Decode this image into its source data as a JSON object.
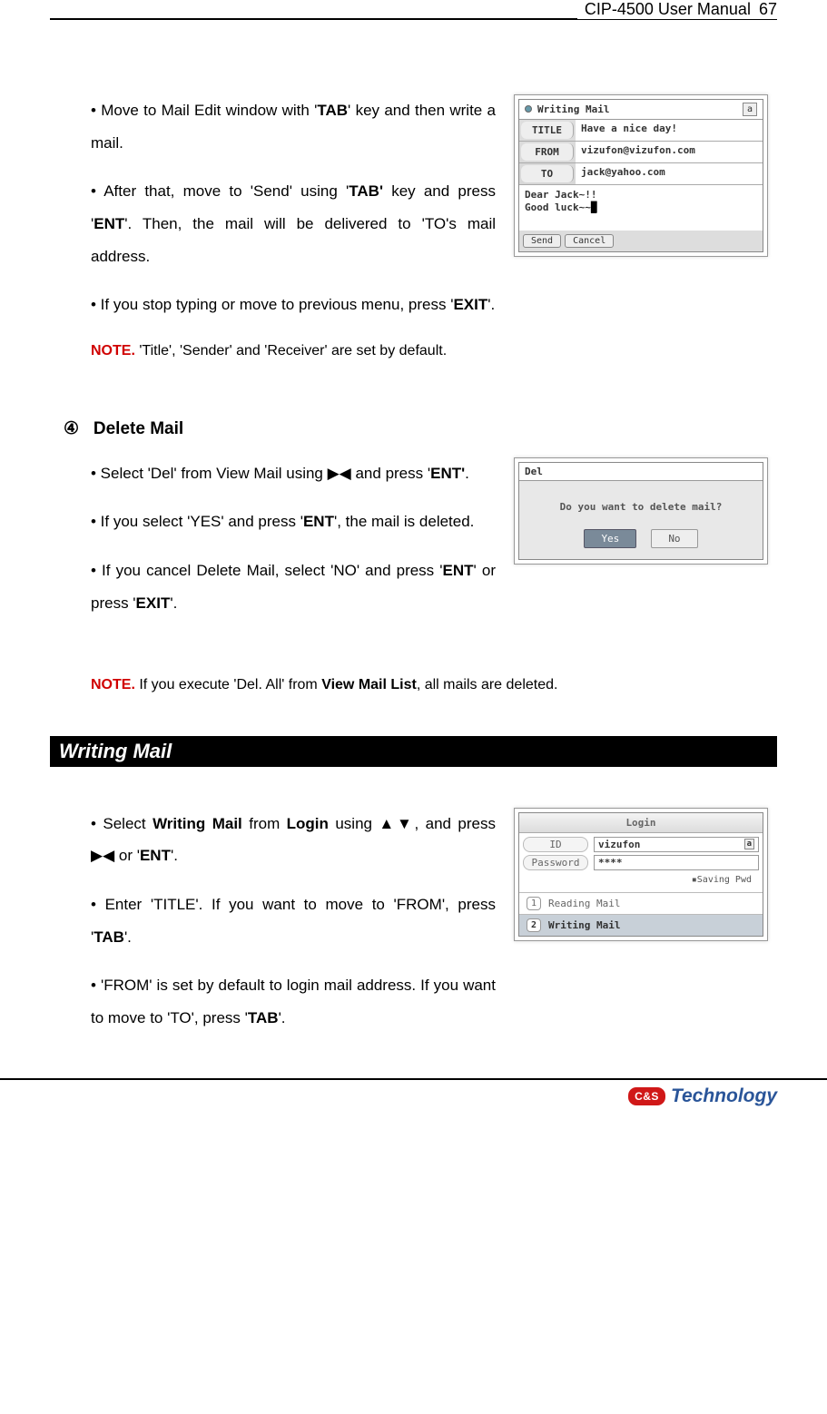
{
  "header": {
    "title": "CIP-4500 User Manual",
    "page": "67"
  },
  "section1": {
    "p1_pre": "• Move to Mail Edit window with '",
    "p1_bold": "TAB",
    "p1_post": "' key and then write a mail.",
    "p2_a": "• After that, move to 'Send' using '",
    "p2_b1": "TAB'",
    "p2_c": " key and press '",
    "p2_b2": "ENT",
    "p2_d": "'. Then, the mail will be delivered to 'TO's mail address.",
    "p3_a": "• If you stop typing or move to previous menu, press '",
    "p3_b": "EXIT",
    "p3_c": "'.",
    "note_label": "NOTE.",
    "note_text": " 'Title', 'Sender' and 'Receiver' are set by default."
  },
  "shot1": {
    "window_title": "Writing Mail",
    "lang": "a",
    "title_lbl": "TITLE",
    "title_val": "Have a nice day!",
    "from_lbl": "FROM",
    "from_val": "vizufon@vizufon.com",
    "to_lbl": "TO",
    "to_val": "jack@yahoo.com",
    "body_line1": "Dear Jack~!!",
    "body_line2": "Good luck~~",
    "btn_send": "Send",
    "btn_cancel": "Cancel"
  },
  "section2": {
    "heading_num": "④",
    "heading_text": "Delete Mail",
    "p1_a": "• Select 'Del' from View Mail using ▶◀ and press '",
    "p1_b": "ENT'",
    "p1_c": ".",
    "p2_a": "• If you select 'YES' and press '",
    "p2_b": "ENT",
    "p2_c": "', the mail is deleted.",
    "p3_a": "• If you cancel Delete Mail, select 'NO' and press '",
    "p3_b": "ENT",
    "p3_c": "' or press '",
    "p3_d": "EXIT",
    "p3_e": "'.",
    "note_label": "NOTE.",
    "note_a": " If you execute 'Del. All' from ",
    "note_b": "View Mail List",
    "note_c": ", all mails are deleted."
  },
  "shot2": {
    "title": "Del",
    "question": "Do you want to delete mail?",
    "yes": "Yes",
    "no": "No"
  },
  "section3": {
    "banner": "Writing Mail",
    "p1_a": "• Select ",
    "p1_b1": "Writing Mail",
    "p1_c": " from ",
    "p1_b2": "Login",
    "p1_d": " using ▲▼, and press ▶◀ or '",
    "p1_b3": "ENT",
    "p1_e": "'.",
    "p2_a": "• Enter 'TITLE'. If you want to move to 'FROM', press '",
    "p2_b": "TAB",
    "p2_c": "'.",
    "p3_a": "• 'FROM' is set by default to login mail address. If you want to move to 'TO', press '",
    "p3_b": "TAB",
    "p3_c": "'."
  },
  "shot3": {
    "login_title": "Login",
    "id_lbl": "ID",
    "id_val": "vizufon",
    "id_lang": "a",
    "pw_lbl": "Password",
    "pw_val": "****",
    "saving": "▪Saving Pwd",
    "menu1_num": "1",
    "menu1_text": "Reading Mail",
    "menu2_num": "2",
    "menu2_text": "Writing Mail"
  },
  "footer": {
    "logo_badge": "C&S",
    "logo_text": "Technology"
  }
}
